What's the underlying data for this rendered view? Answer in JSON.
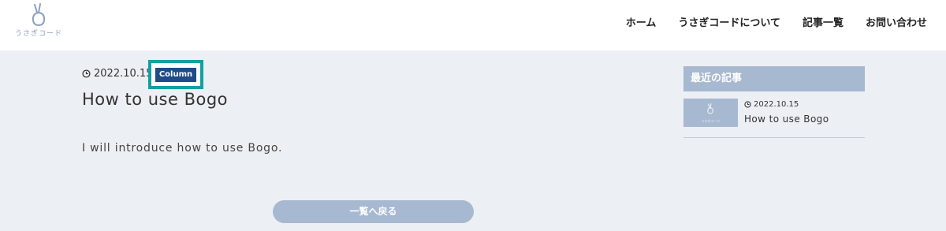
{
  "header": {
    "logo_text": "うさぎコード",
    "nav": [
      {
        "label": "ホーム"
      },
      {
        "label": "うさぎコードについて"
      },
      {
        "label": "記事一覧"
      },
      {
        "label": "お問い合わせ"
      }
    ]
  },
  "article": {
    "date": "2022.10.15",
    "category": "Column",
    "title": "How to use Bogo",
    "body": "I will introduce how to use Bogo.",
    "back_label": "一覧へ戻る"
  },
  "sidebar": {
    "heading": "最近の記事",
    "items": [
      {
        "date": "2022.10.15",
        "title": "How to use Bogo",
        "thumb_text": "うさぎコード"
      }
    ]
  },
  "colors": {
    "accent": "#a7b8d1",
    "badge": "#1f4b87",
    "highlight": "#13a0a3",
    "background": "#eceff4"
  }
}
